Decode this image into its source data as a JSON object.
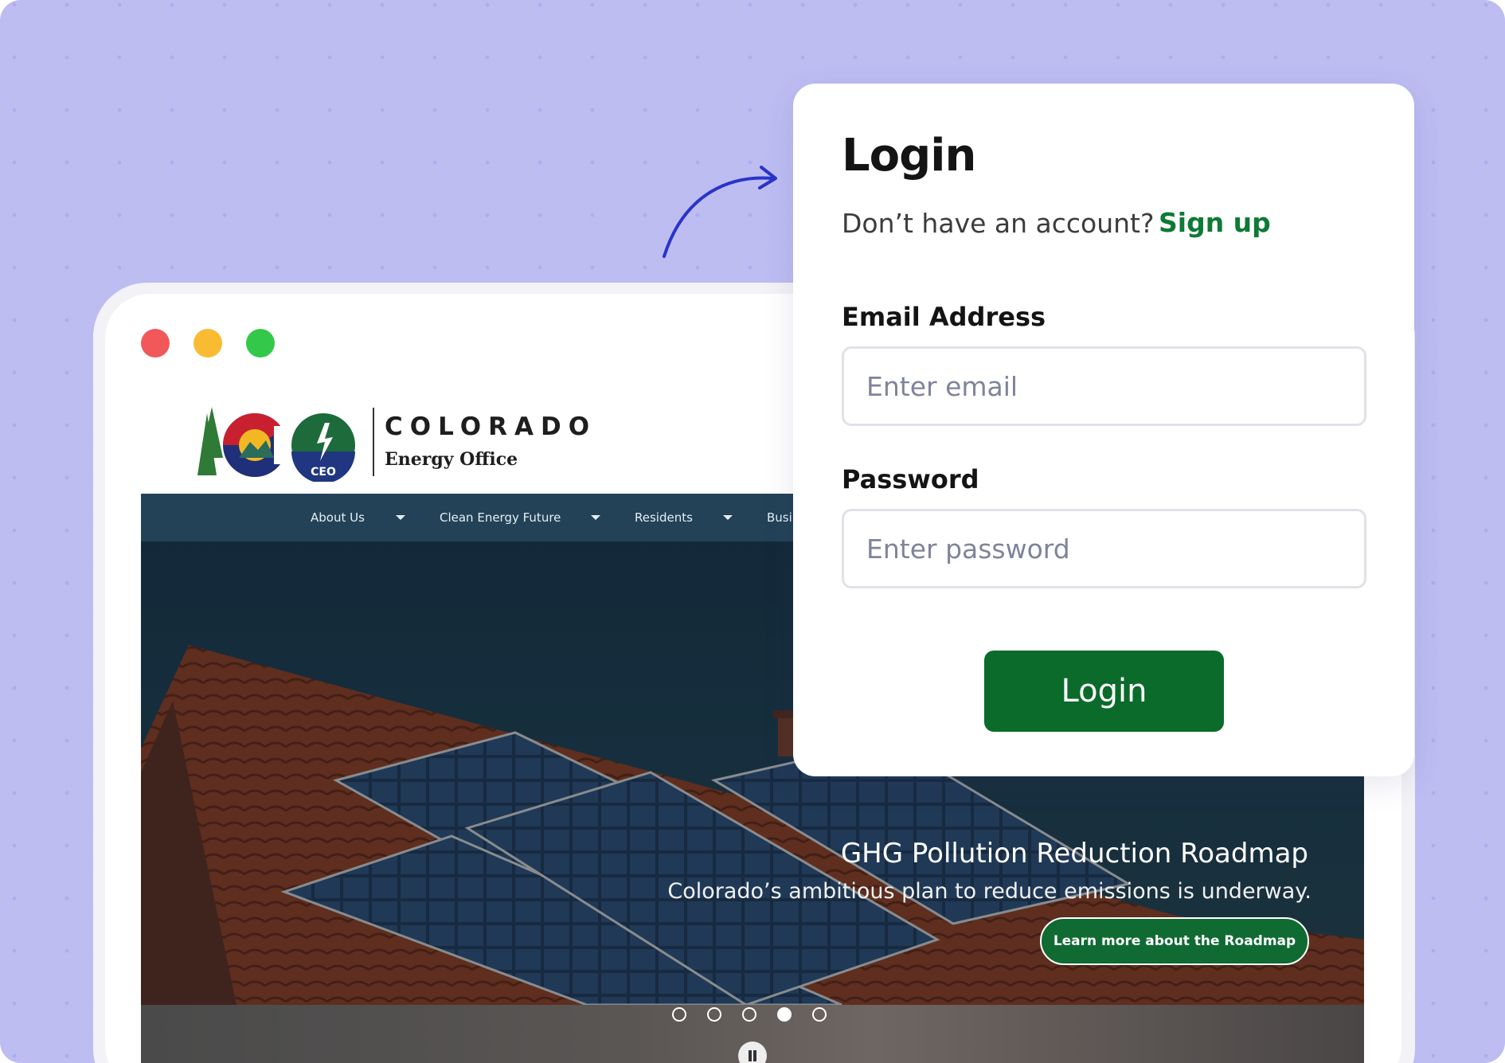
{
  "browser": {
    "window_controls": [
      "close",
      "minimize",
      "maximize"
    ]
  },
  "site": {
    "logo_title": "COLORADO",
    "logo_subtitle": "Energy Office",
    "logo_badge": "CEO",
    "nav": [
      {
        "label": "About Us",
        "has_dropdown": true
      },
      {
        "label": "Clean Energy Future",
        "has_dropdown": true
      },
      {
        "label": "Residents",
        "has_dropdown": true
      },
      {
        "label": "Busi",
        "has_dropdown": false
      }
    ],
    "hero": {
      "title": "GHG Pollution Reduction Roadmap",
      "subtitle": "Colorado’s ambitious plan to reduce emissions is underway.",
      "cta_label": "Learn more about the Roadmap"
    },
    "slider": {
      "slide_count": 5,
      "active_index": 3,
      "pause_icon": "pause-icon"
    }
  },
  "login": {
    "title": "Login",
    "signup_prompt": "Don’t have an account?",
    "signup_link": "Sign up",
    "email_label": "Email Address",
    "email_placeholder": "Enter email",
    "email_value": "",
    "password_label": "Password",
    "password_placeholder": "Enter password",
    "password_value": "",
    "submit_label": "Login"
  },
  "colors": {
    "background": "#dcdcf8",
    "accent_green": "#0b6b2a",
    "link_green": "#0e7a35",
    "nav_bar": "#234257",
    "arrow": "#2a34c8"
  }
}
